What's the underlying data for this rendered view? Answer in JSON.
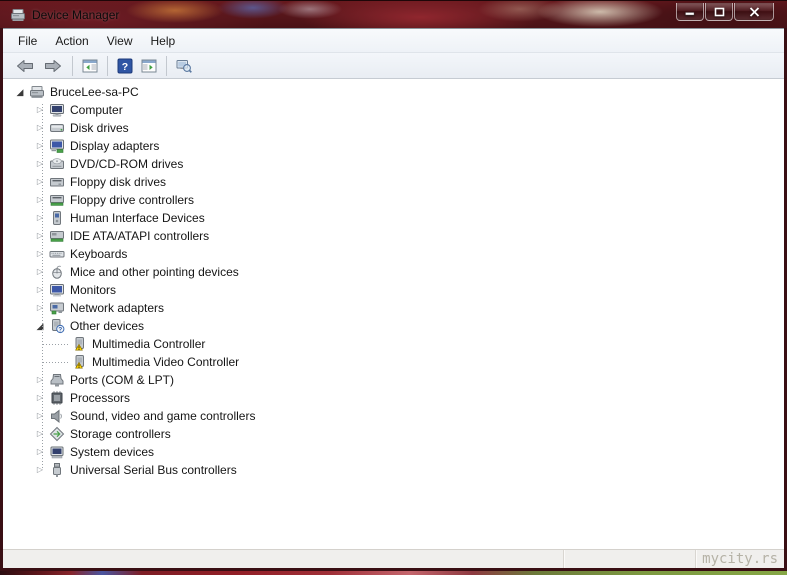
{
  "window": {
    "title": "Device Manager"
  },
  "menu": {
    "items": [
      "File",
      "Action",
      "View",
      "Help"
    ]
  },
  "toolbar": {
    "buttons": [
      "back",
      "forward",
      "show-console-tree",
      "help",
      "show-action-pane",
      "scan-for-hardware-changes"
    ]
  },
  "tree": {
    "items": [
      {
        "label": "BruceLee-sa-PC",
        "level": 0,
        "icon": "computer-root",
        "state": "expanded"
      },
      {
        "label": "Computer",
        "level": 1,
        "icon": "computer",
        "state": "collapsed"
      },
      {
        "label": "Disk drives",
        "level": 1,
        "icon": "disk-drive",
        "state": "collapsed"
      },
      {
        "label": "Display adapters",
        "level": 1,
        "icon": "display-adapter",
        "state": "collapsed"
      },
      {
        "label": "DVD/CD-ROM drives",
        "level": 1,
        "icon": "cd-drive",
        "state": "collapsed"
      },
      {
        "label": "Floppy disk drives",
        "level": 1,
        "icon": "floppy-drive",
        "state": "collapsed"
      },
      {
        "label": "Floppy drive controllers",
        "level": 1,
        "icon": "floppy-controller",
        "state": "collapsed"
      },
      {
        "label": "Human Interface Devices",
        "level": 1,
        "icon": "hid",
        "state": "collapsed"
      },
      {
        "label": "IDE ATA/ATAPI controllers",
        "level": 1,
        "icon": "ide-controller",
        "state": "collapsed"
      },
      {
        "label": "Keyboards",
        "level": 1,
        "icon": "keyboard",
        "state": "collapsed"
      },
      {
        "label": "Mice and other pointing devices",
        "level": 1,
        "icon": "mouse",
        "state": "collapsed"
      },
      {
        "label": "Monitors",
        "level": 1,
        "icon": "monitor",
        "state": "collapsed"
      },
      {
        "label": "Network adapters",
        "level": 1,
        "icon": "network-adapter",
        "state": "collapsed"
      },
      {
        "label": "Other devices",
        "level": 1,
        "icon": "unknown-device",
        "state": "expanded"
      },
      {
        "label": "Multimedia Controller",
        "level": 2,
        "icon": "warning-device",
        "state": "none"
      },
      {
        "label": "Multimedia Video Controller",
        "level": 2,
        "icon": "warning-device",
        "state": "none"
      },
      {
        "label": "Ports (COM & LPT)",
        "level": 1,
        "icon": "serial-port",
        "state": "collapsed"
      },
      {
        "label": "Processors",
        "level": 1,
        "icon": "processor",
        "state": "collapsed"
      },
      {
        "label": "Sound, video and game controllers",
        "level": 1,
        "icon": "sound",
        "state": "collapsed"
      },
      {
        "label": "Storage controllers",
        "level": 1,
        "icon": "storage-controller",
        "state": "collapsed"
      },
      {
        "label": "System devices",
        "level": 1,
        "icon": "system-device",
        "state": "collapsed"
      },
      {
        "label": "Universal Serial Bus controllers",
        "level": 1,
        "icon": "usb-controller",
        "state": "collapsed"
      }
    ]
  },
  "statusbar": {
    "watermark": "mycity.rs"
  },
  "colors": {
    "titlebar_glass": "#57161b",
    "frame_border": "#3a0f14",
    "warning_yellow": "#ffd400",
    "help_blue": "#2f55a4",
    "content_bg": "#ffffff",
    "statusbar_bg": "#f0efed"
  }
}
